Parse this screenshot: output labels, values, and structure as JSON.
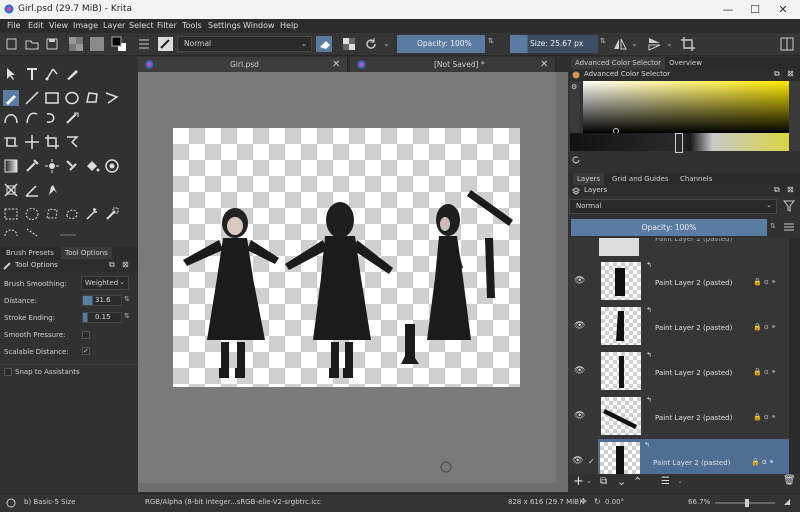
{
  "window": {
    "title": "Girl.psd (29.7 MiB)  - Krita",
    "minimize": "—",
    "maximize": "☐",
    "close": "✕"
  },
  "menu": [
    "File",
    "Edit",
    "View",
    "Image",
    "Layer",
    "Select",
    "Filter",
    "Tools",
    "Settings",
    "Window",
    "Help"
  ],
  "toolbar": {
    "blend_mode": "Normal",
    "opacity": "Opacity: 100%",
    "size": "Size: 25.67 px"
  },
  "left_docker": {
    "tabs": [
      "Brush Presets",
      "Tool Options"
    ],
    "panel_title": "Tool Options",
    "brush_smoothing_label": "Brush Smoothing:",
    "brush_smoothing_value": "Weighted",
    "distance_label": "Distance:",
    "distance_value": "31.6",
    "stroke_ending_label": "Stroke Ending:",
    "stroke_ending_value": "0.15",
    "smooth_pressure_label": "Smooth Pressure:",
    "scalable_distance_label": "Scalable Distance:",
    "scalable_distance_check": "✓",
    "snap_label": "Snap to Assistants"
  },
  "documents": {
    "tabs": [
      {
        "label": "Girl.psd"
      },
      {
        "label": "[Not Saved]  *"
      }
    ]
  },
  "right_docker": {
    "color_tabs": [
      "Advanced Color Selector",
      "Overview"
    ],
    "color_title": "Advanced Color Selector",
    "layer_tabs": [
      "Layers",
      "Grid and Guides",
      "Channels"
    ],
    "layers_title": "Layers",
    "blend_mode": "Normal",
    "opacity": "Opacity:  100%",
    "layers": [
      {
        "name": "Paint Layer 2 (pasted)"
      },
      {
        "name": "Paint Layer 2 (pasted)"
      },
      {
        "name": "Paint Layer 2 (pasted)"
      },
      {
        "name": "Paint Layer 2 (pasted)"
      },
      {
        "name": "Paint Layer 2 (pasted)",
        "selected": true
      }
    ]
  },
  "statusbar": {
    "brush": "b) Basic-5 Size",
    "color_space": "RGB/Alpha (8-bit integer...sRGB-elle-V2-srgbtrc.icc",
    "dimensions": "828 x 616 (29.7 MiB)",
    "rotation": "0.00°",
    "zoom": "66.7%"
  },
  "colors": {
    "accent": "#5a7ca2",
    "selected_layer": "#4e6f93"
  }
}
